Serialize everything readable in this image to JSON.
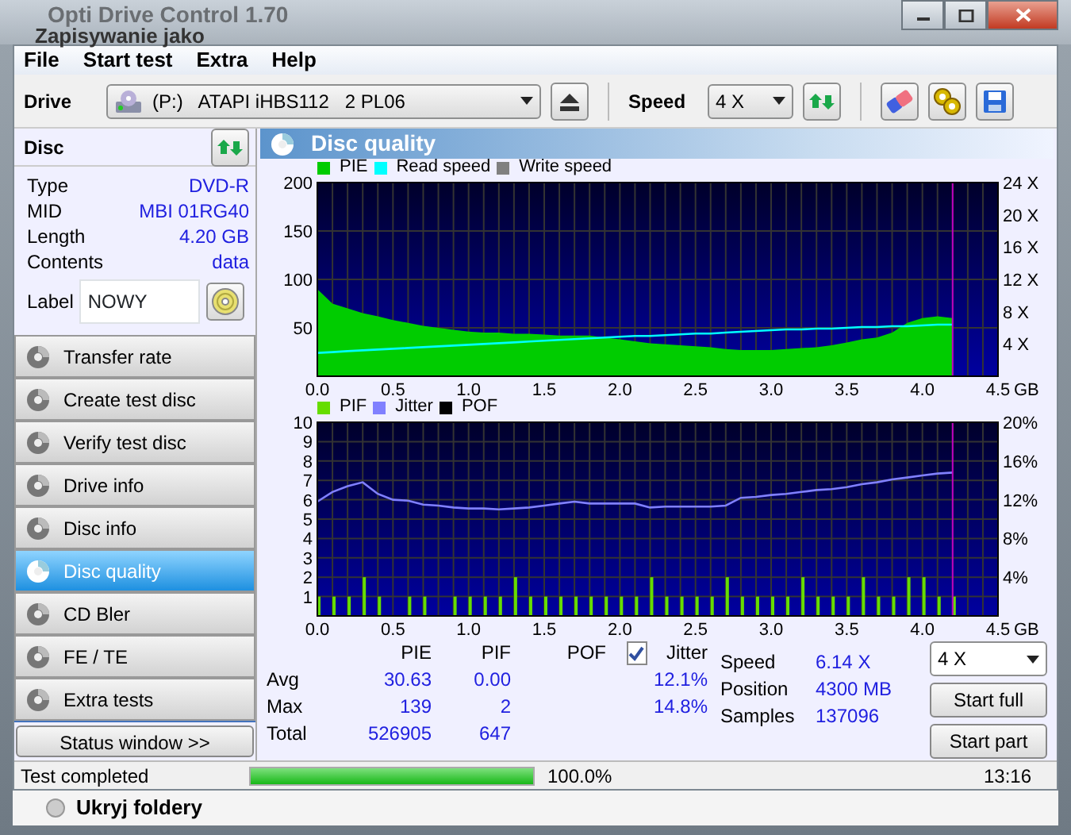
{
  "window": {
    "title": "Opti Drive Control 1.70",
    "behind_title": "Zapisywanie jako"
  },
  "menu": [
    "File",
    "Start test",
    "Extra",
    "Help"
  ],
  "toolbar": {
    "drive_label": "Drive",
    "drive": "(P:)   ATAPI iHBS112   2 PL06",
    "speed_label": "Speed",
    "speed": "4 X"
  },
  "disc": {
    "title": "Disc",
    "info": [
      {
        "label": "Type",
        "value": "DVD-R"
      },
      {
        "label": "MID",
        "value": "MBI 01RG40"
      },
      {
        "label": "Length",
        "value": "4.20 GB"
      },
      {
        "label": "Contents",
        "value": "data"
      }
    ],
    "label_caption": "Label",
    "label_value": "NOWY"
  },
  "nav": [
    {
      "label": "Transfer rate",
      "selected": false
    },
    {
      "label": "Create test disc",
      "selected": false
    },
    {
      "label": "Verify test disc",
      "selected": false
    },
    {
      "label": "Drive info",
      "selected": false
    },
    {
      "label": "Disc info",
      "selected": false
    },
    {
      "label": "Disc quality",
      "selected": true
    },
    {
      "label": "CD Bler",
      "selected": false
    },
    {
      "label": "FE / TE",
      "selected": false
    },
    {
      "label": "Extra tests",
      "selected": false
    }
  ],
  "status_window_button": "Status window >>",
  "panel": {
    "title": "Disc quality",
    "charts": [
      {
        "legend_extra": [
          {
            "label": "Write speed",
            "color": "#808080"
          }
        ],
        "chart_data": {
          "type": "area",
          "grid": true,
          "ref_lines": [
            {
              "axis": "x",
              "value": 4.2,
              "color": "#c000c0"
            }
          ],
          "xlabel": "GB",
          "x": [
            0,
            0.1,
            0.2,
            0.3,
            0.4,
            0.5,
            0.6,
            0.7,
            0.8,
            0.9,
            1.0,
            1.1,
            1.2,
            1.3,
            1.4,
            1.5,
            1.6,
            1.7,
            1.8,
            1.9,
            2.0,
            2.1,
            2.2,
            2.3,
            2.4,
            2.5,
            2.6,
            2.7,
            2.8,
            2.9,
            3.0,
            3.1,
            3.2,
            3.3,
            3.4,
            3.5,
            3.6,
            3.7,
            3.8,
            3.9,
            4.0,
            4.1,
            4.2
          ],
          "xlim": [
            0,
            4.5
          ],
          "ylim": [
            0,
            200
          ],
          "y2lim": [
            0,
            24
          ],
          "xticks": [
            {
              "value": 0,
              "label": "0.0"
            },
            {
              "value": 0.5,
              "label": "0.5"
            },
            {
              "value": 1,
              "label": "1.0"
            },
            {
              "value": 1.5,
              "label": "1.5"
            },
            {
              "value": 2,
              "label": "2.0"
            },
            {
              "value": 2.5,
              "label": "2.5"
            },
            {
              "value": 3,
              "label": "3.0"
            },
            {
              "value": 3.5,
              "label": "3.5"
            },
            {
              "value": 4,
              "label": "4.0"
            },
            {
              "value": 4.5,
              "label": "4.5"
            }
          ],
          "yticks": [
            50,
            100,
            150,
            200
          ],
          "y2ticks": [
            {
              "value": 4,
              "label": "4 X"
            },
            {
              "value": 8,
              "label": "8 X"
            },
            {
              "value": 12,
              "label": "12 X"
            },
            {
              "value": 16,
              "label": "16 X"
            },
            {
              "value": 20,
              "label": "20 X"
            },
            {
              "value": 24,
              "label": "24 X"
            }
          ],
          "series": [
            {
              "name": "PIE",
              "color": "#00cc00",
              "values": [
                90,
                75,
                70,
                65,
                62,
                58,
                55,
                52,
                50,
                48,
                46,
                45,
                45,
                44,
                44,
                43,
                42,
                42,
                42,
                40,
                38,
                36,
                34,
                33,
                32,
                31,
                30,
                28,
                27,
                27,
                27,
                28,
                29,
                30,
                32,
                35,
                38,
                40,
                45,
                55,
                60,
                62,
                60
              ]
            },
            {
              "name": "Read speed",
              "color": "#00ffff",
              "type": "line",
              "axis": "y2",
              "values": [
                2.9,
                3.0,
                3.1,
                3.2,
                3.3,
                3.4,
                3.5,
                3.6,
                3.7,
                3.8,
                3.9,
                4.0,
                4.1,
                4.2,
                4.3,
                4.4,
                4.5,
                4.6,
                4.7,
                4.8,
                4.9,
                5.0,
                5.0,
                5.1,
                5.2,
                5.3,
                5.3,
                5.4,
                5.5,
                5.6,
                5.7,
                5.8,
                5.8,
                5.9,
                5.9,
                6.0,
                6.1,
                6.1,
                6.2,
                6.2,
                6.3,
                6.4,
                6.4
              ]
            }
          ]
        }
      },
      {
        "legend_extra": [
          {
            "label": "POF",
            "color": "#000000"
          }
        ],
        "chart_data": {
          "type": "bar",
          "grid": true,
          "ref_lines": [
            {
              "axis": "x",
              "value": 4.2,
              "color": "#c000c0"
            }
          ],
          "xlabel": "GB",
          "x": [
            0,
            0.1,
            0.2,
            0.3,
            0.4,
            0.5,
            0.6,
            0.7,
            0.8,
            0.9,
            1.0,
            1.1,
            1.2,
            1.3,
            1.4,
            1.5,
            1.6,
            1.7,
            1.8,
            1.9,
            2.0,
            2.1,
            2.2,
            2.3,
            2.4,
            2.5,
            2.6,
            2.7,
            2.8,
            2.9,
            3.0,
            3.1,
            3.2,
            3.3,
            3.4,
            3.5,
            3.6,
            3.7,
            3.8,
            3.9,
            4.0,
            4.1,
            4.2
          ],
          "xlim": [
            0,
            4.5
          ],
          "ylim": [
            0,
            10
          ],
          "y2lim": [
            0,
            20
          ],
          "xticks": [
            {
              "value": 0,
              "label": "0.0"
            },
            {
              "value": 0.5,
              "label": "0.5"
            },
            {
              "value": 1,
              "label": "1.0"
            },
            {
              "value": 1.5,
              "label": "1.5"
            },
            {
              "value": 2,
              "label": "2.0"
            },
            {
              "value": 2.5,
              "label": "2.5"
            },
            {
              "value": 3,
              "label": "3.0"
            },
            {
              "value": 3.5,
              "label": "3.5"
            },
            {
              "value": 4,
              "label": "4.0"
            },
            {
              "value": 4.5,
              "label": "4.5"
            }
          ],
          "yticks": [
            1,
            2,
            3,
            4,
            5,
            6,
            7,
            8,
            9,
            10
          ],
          "y2ticks": [
            {
              "value": 4,
              "label": "4%"
            },
            {
              "value": 8,
              "label": "8%"
            },
            {
              "value": 12,
              "label": "12%"
            },
            {
              "value": 16,
              "label": "16%"
            },
            {
              "value": 20,
              "label": "20%"
            }
          ],
          "series": [
            {
              "name": "PIF",
              "color": "#66dd00",
              "values": [
                1,
                1,
                1,
                2,
                1,
                0,
                1,
                1,
                0,
                1,
                1,
                1,
                1,
                2,
                1,
                1,
                1,
                1,
                1,
                1,
                1,
                1,
                2,
                1,
                1,
                1,
                1,
                2,
                1,
                1,
                1,
                1,
                2,
                1,
                1,
                1,
                2,
                1,
                1,
                2,
                2,
                1,
                1
              ]
            },
            {
              "name": "Jitter",
              "color": "#8080ff",
              "type": "line",
              "axis": "y2",
              "values": [
                11.8,
                12.8,
                13.4,
                13.8,
                12.6,
                12.0,
                11.9,
                11.5,
                11.4,
                11.2,
                11.1,
                11.1,
                11.0,
                11.1,
                11.2,
                11.4,
                11.6,
                11.8,
                11.6,
                11.6,
                11.6,
                11.6,
                11.2,
                11.3,
                11.3,
                11.3,
                11.3,
                11.4,
                12.2,
                12.3,
                12.5,
                12.6,
                12.8,
                13.0,
                13.1,
                13.3,
                13.6,
                13.8,
                14.1,
                14.3,
                14.5,
                14.7,
                14.8
              ]
            }
          ]
        }
      }
    ],
    "stats": {
      "columns": [
        "PIE",
        "PIF",
        "POF",
        "Jitter"
      ],
      "jitter_checked": true,
      "rows": [
        {
          "label": "Avg",
          "pie": "30.63",
          "pif": "0.00",
          "jitter": "12.1%"
        },
        {
          "label": "Max",
          "pie": "139",
          "pif": "2",
          "jitter": "14.8%"
        },
        {
          "label": "Total",
          "pie": "526905",
          "pif": "647"
        }
      ],
      "info": [
        {
          "label": "Speed",
          "value": "6.14 X"
        },
        {
          "label": "Position",
          "value": "4300 MB"
        },
        {
          "label": "Samples",
          "value": "137096"
        }
      ],
      "speed_select": "4 X",
      "buttons": [
        "Start full",
        "Start part"
      ]
    }
  },
  "status_bar": {
    "message": "Test completed",
    "progress": {
      "level": 1.0
    },
    "percent": "100.0%",
    "time": "13:16"
  },
  "behind_window_text": "Ukryj foldery"
}
